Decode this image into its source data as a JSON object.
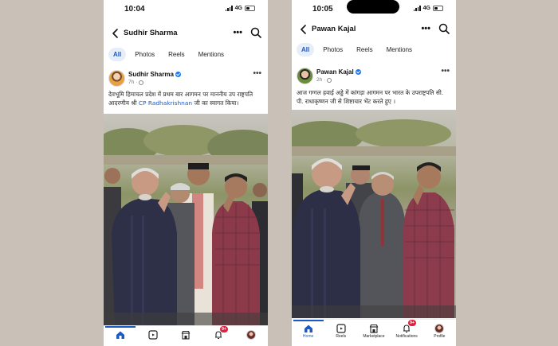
{
  "left": {
    "status": {
      "time": "10:04",
      "network": "4G"
    },
    "header": {
      "title": "Sudhir Sharma"
    },
    "tabs": [
      {
        "label": "All"
      },
      {
        "label": "Photos"
      },
      {
        "label": "Reels"
      },
      {
        "label": "Mentions"
      }
    ],
    "post": {
      "author": "Sudhir Sharma",
      "time": "7h",
      "caption_part1": "देवभूमि हिमाचल प्रदेश में प्रथम बार आगमन पर माननीय उप राष्ट्रपति आदरणीय श्री ",
      "mention": "CP Radhakrishnan",
      "caption_part2": " जी का स्वागत किया।"
    },
    "bottom_nav": {
      "badge": "9+"
    }
  },
  "right": {
    "status": {
      "time": "10:05",
      "network": "4G"
    },
    "header": {
      "title": "Pawan Kajal"
    },
    "tabs": [
      {
        "label": "All"
      },
      {
        "label": "Photos"
      },
      {
        "label": "Reels"
      },
      {
        "label": "Mentions"
      }
    ],
    "post": {
      "author": "Pawan Kajal",
      "time": "2h",
      "caption": "आज गग्गल हवाई अड्डे में कांगड़ा आगमन पर भारत के उपराष्ट्रपति सी. पी. राधाकृष्णन जी से शिष्टाचार भेंट करते हुए ।"
    },
    "bottom_nav": {
      "items": [
        {
          "label": "Home"
        },
        {
          "label": "Reels"
        },
        {
          "label": "Marketplace"
        },
        {
          "label": "Notifications"
        },
        {
          "label": "Profile"
        }
      ],
      "badge": "9+"
    }
  },
  "colors": {
    "accent": "#1a5ac7",
    "badge": "#e41e3f",
    "background": "#c9c1b8"
  }
}
